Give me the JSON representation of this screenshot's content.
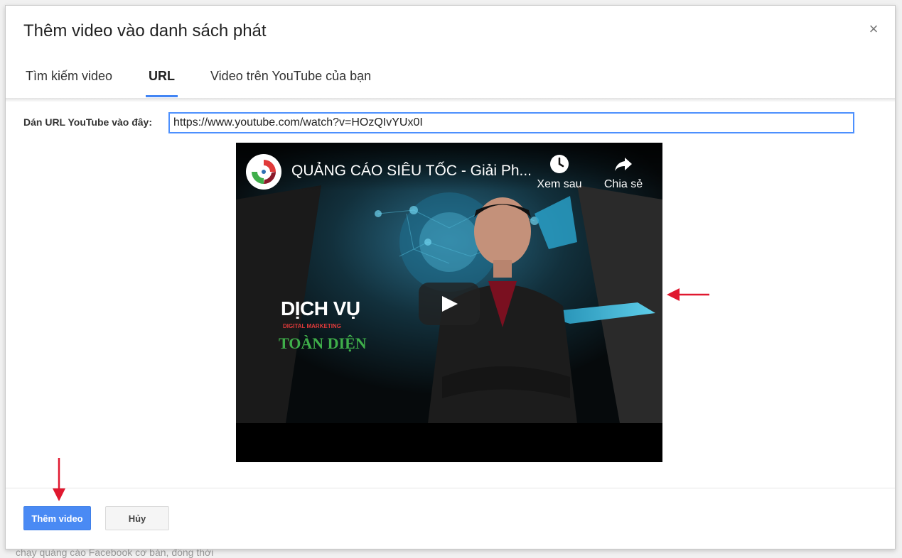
{
  "background_text": "chạy quảng cáo Facebook cơ bản, đồng thời",
  "dialog": {
    "title": "Thêm video vào danh sách phát",
    "close_glyph": "×"
  },
  "tabs": [
    {
      "label": "Tìm kiếm video",
      "active": false
    },
    {
      "label": "URL",
      "active": true
    },
    {
      "label": "Video trên YouTube của bạn",
      "active": false
    }
  ],
  "url_field": {
    "label": "Dán URL YouTube vào đây:",
    "value": "https://www.youtube.com/watch?v=HOzQIvYUx0I"
  },
  "video_preview": {
    "title": "QUẢNG CÁO SIÊU TỐC - Giải Ph...",
    "watch_later_label": "Xem sau",
    "share_label": "Chia sẻ",
    "thumbnail_text": {
      "title": "DỊCH VỤ",
      "subtitle": "DIGITAL MARKETING",
      "tagline": "TOÀN DIỆN"
    }
  },
  "buttons": {
    "add_video": "Thêm video",
    "cancel": "Hủy"
  },
  "colors": {
    "accent": "#4285f4",
    "primary_button": "#4a8af4",
    "annotation_arrow": "#e0182f",
    "brand_red": "#e03a3a",
    "brand_green": "#3fae4a"
  },
  "icons": [
    "close-icon",
    "clock-icon",
    "share-icon",
    "play-icon",
    "channel-logo",
    "annotation-arrow"
  ]
}
